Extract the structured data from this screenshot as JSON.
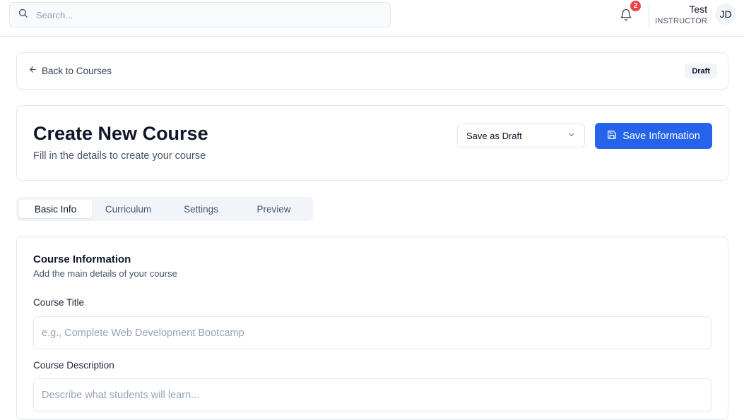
{
  "header": {
    "search_placeholder": "Search...",
    "notification_count": "2",
    "user_name": "Test",
    "user_role": "INSTRUCTOR",
    "avatar_initials": "JD"
  },
  "back_bar": {
    "back_label": "Back to Courses",
    "status_badge": "Draft"
  },
  "page": {
    "title": "Create New Course",
    "subtitle": "Fill in the details to create your course",
    "status_select_value": "Save as Draft",
    "save_button_label": "Save Information"
  },
  "tabs": [
    {
      "label": "Basic Info",
      "active": true
    },
    {
      "label": "Curriculum",
      "active": false
    },
    {
      "label": "Settings",
      "active": false
    },
    {
      "label": "Preview",
      "active": false
    }
  ],
  "form": {
    "section_title": "Course Information",
    "section_subtitle": "Add the main details of your course",
    "course_title_label": "Course Title",
    "course_title_placeholder": "e.g., Complete Web Development Bootcamp",
    "course_description_label": "Course Description",
    "course_description_placeholder": "Describe what students will learn..."
  },
  "colors": {
    "primary": "#2563eb",
    "badge_red": "#ef4444"
  }
}
